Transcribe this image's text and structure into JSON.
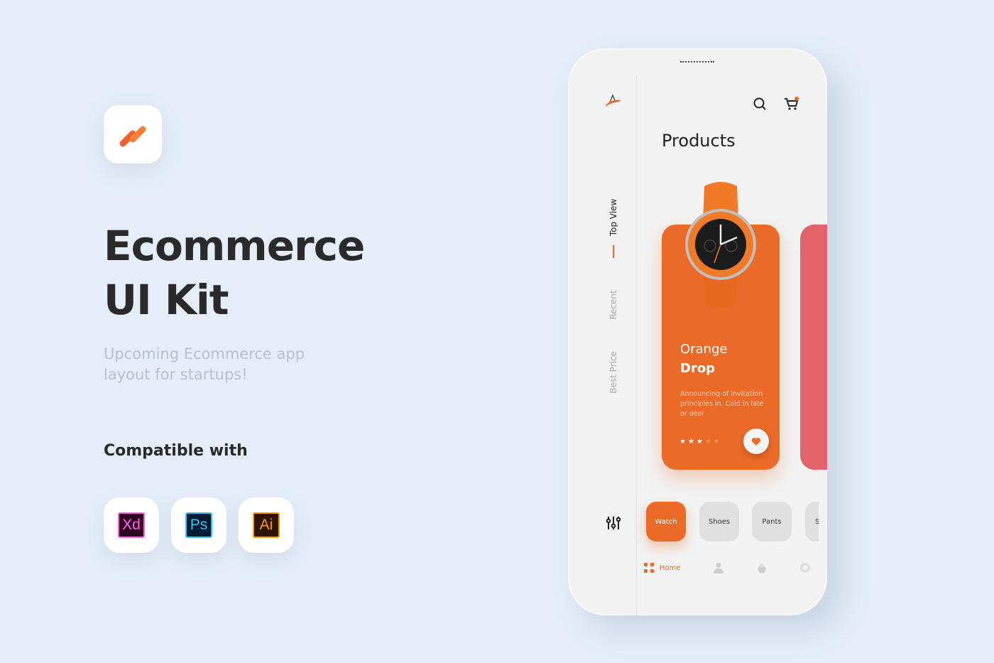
{
  "hero": {
    "title_line1": "Ecommerce",
    "title_line2": "UI Kit",
    "subtitle_line1": "Upcoming Ecommerce app",
    "subtitle_line2": "layout for startups!",
    "compat": "Compatible with",
    "tools": [
      {
        "label": "Xd",
        "bg": "#2e001e",
        "fg": "#ff61f6"
      },
      {
        "label": "Ps",
        "bg": "#001d34",
        "fg": "#31c5f0"
      },
      {
        "label": "Ai",
        "bg": "#2e1300",
        "fg": "#ff9a00"
      }
    ]
  },
  "colors": {
    "accent": "#ec6a27",
    "background": "#e4edf8",
    "second_card": "#e2636a"
  },
  "app": {
    "rail": {
      "items": [
        "Top View",
        "Recent",
        "Best Price"
      ],
      "active": 0
    },
    "title": "Products",
    "cart_badge": true,
    "card": {
      "name_line1": "Orange",
      "name_line2": "Drop",
      "description": "Announcing of invitation principles in. Cold in late or deal",
      "rating": 3,
      "rating_max": 5
    },
    "categories": [
      "Watch",
      "Shoes",
      "Pants",
      "S"
    ],
    "active_category": 0,
    "nav": {
      "home_label": "Home"
    }
  }
}
